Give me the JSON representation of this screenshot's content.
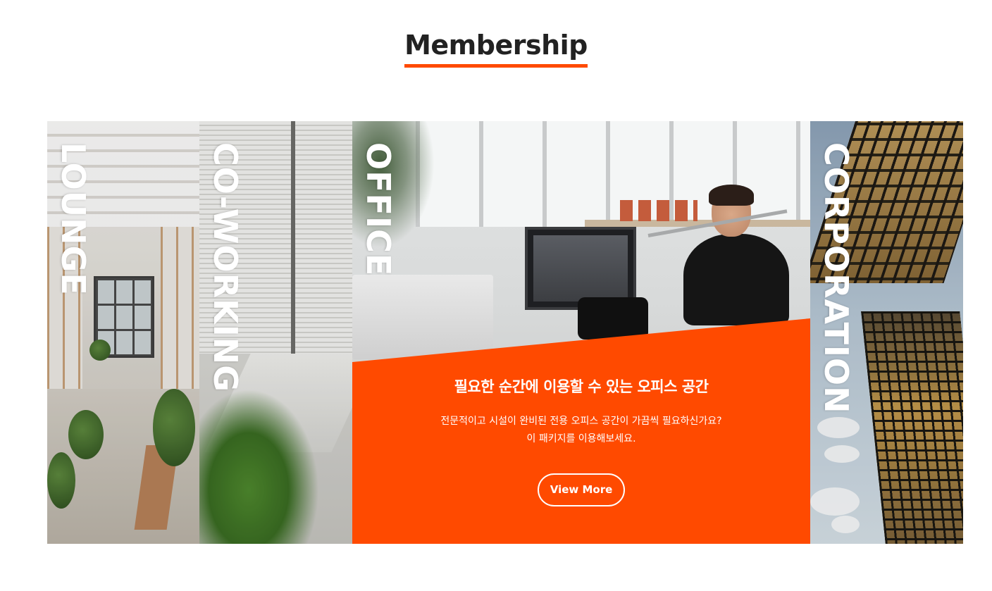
{
  "section": {
    "title": "Membership",
    "accent_color": "#ff4a00"
  },
  "panels": [
    {
      "label": "LOUNGE"
    },
    {
      "label": "CO-WORKING"
    },
    {
      "label": "OFFICE",
      "headline": "필요한 순간에 이용할 수 있는 오피스 공간",
      "description_line1": "전문적이고 시설이 완비된 전용 오피스 공간이 가끔씩 필요하신가요?",
      "description_line2": "이 패키지를 이용해보세요.",
      "button_label": "View More"
    },
    {
      "label": "CORPORATION"
    }
  ]
}
